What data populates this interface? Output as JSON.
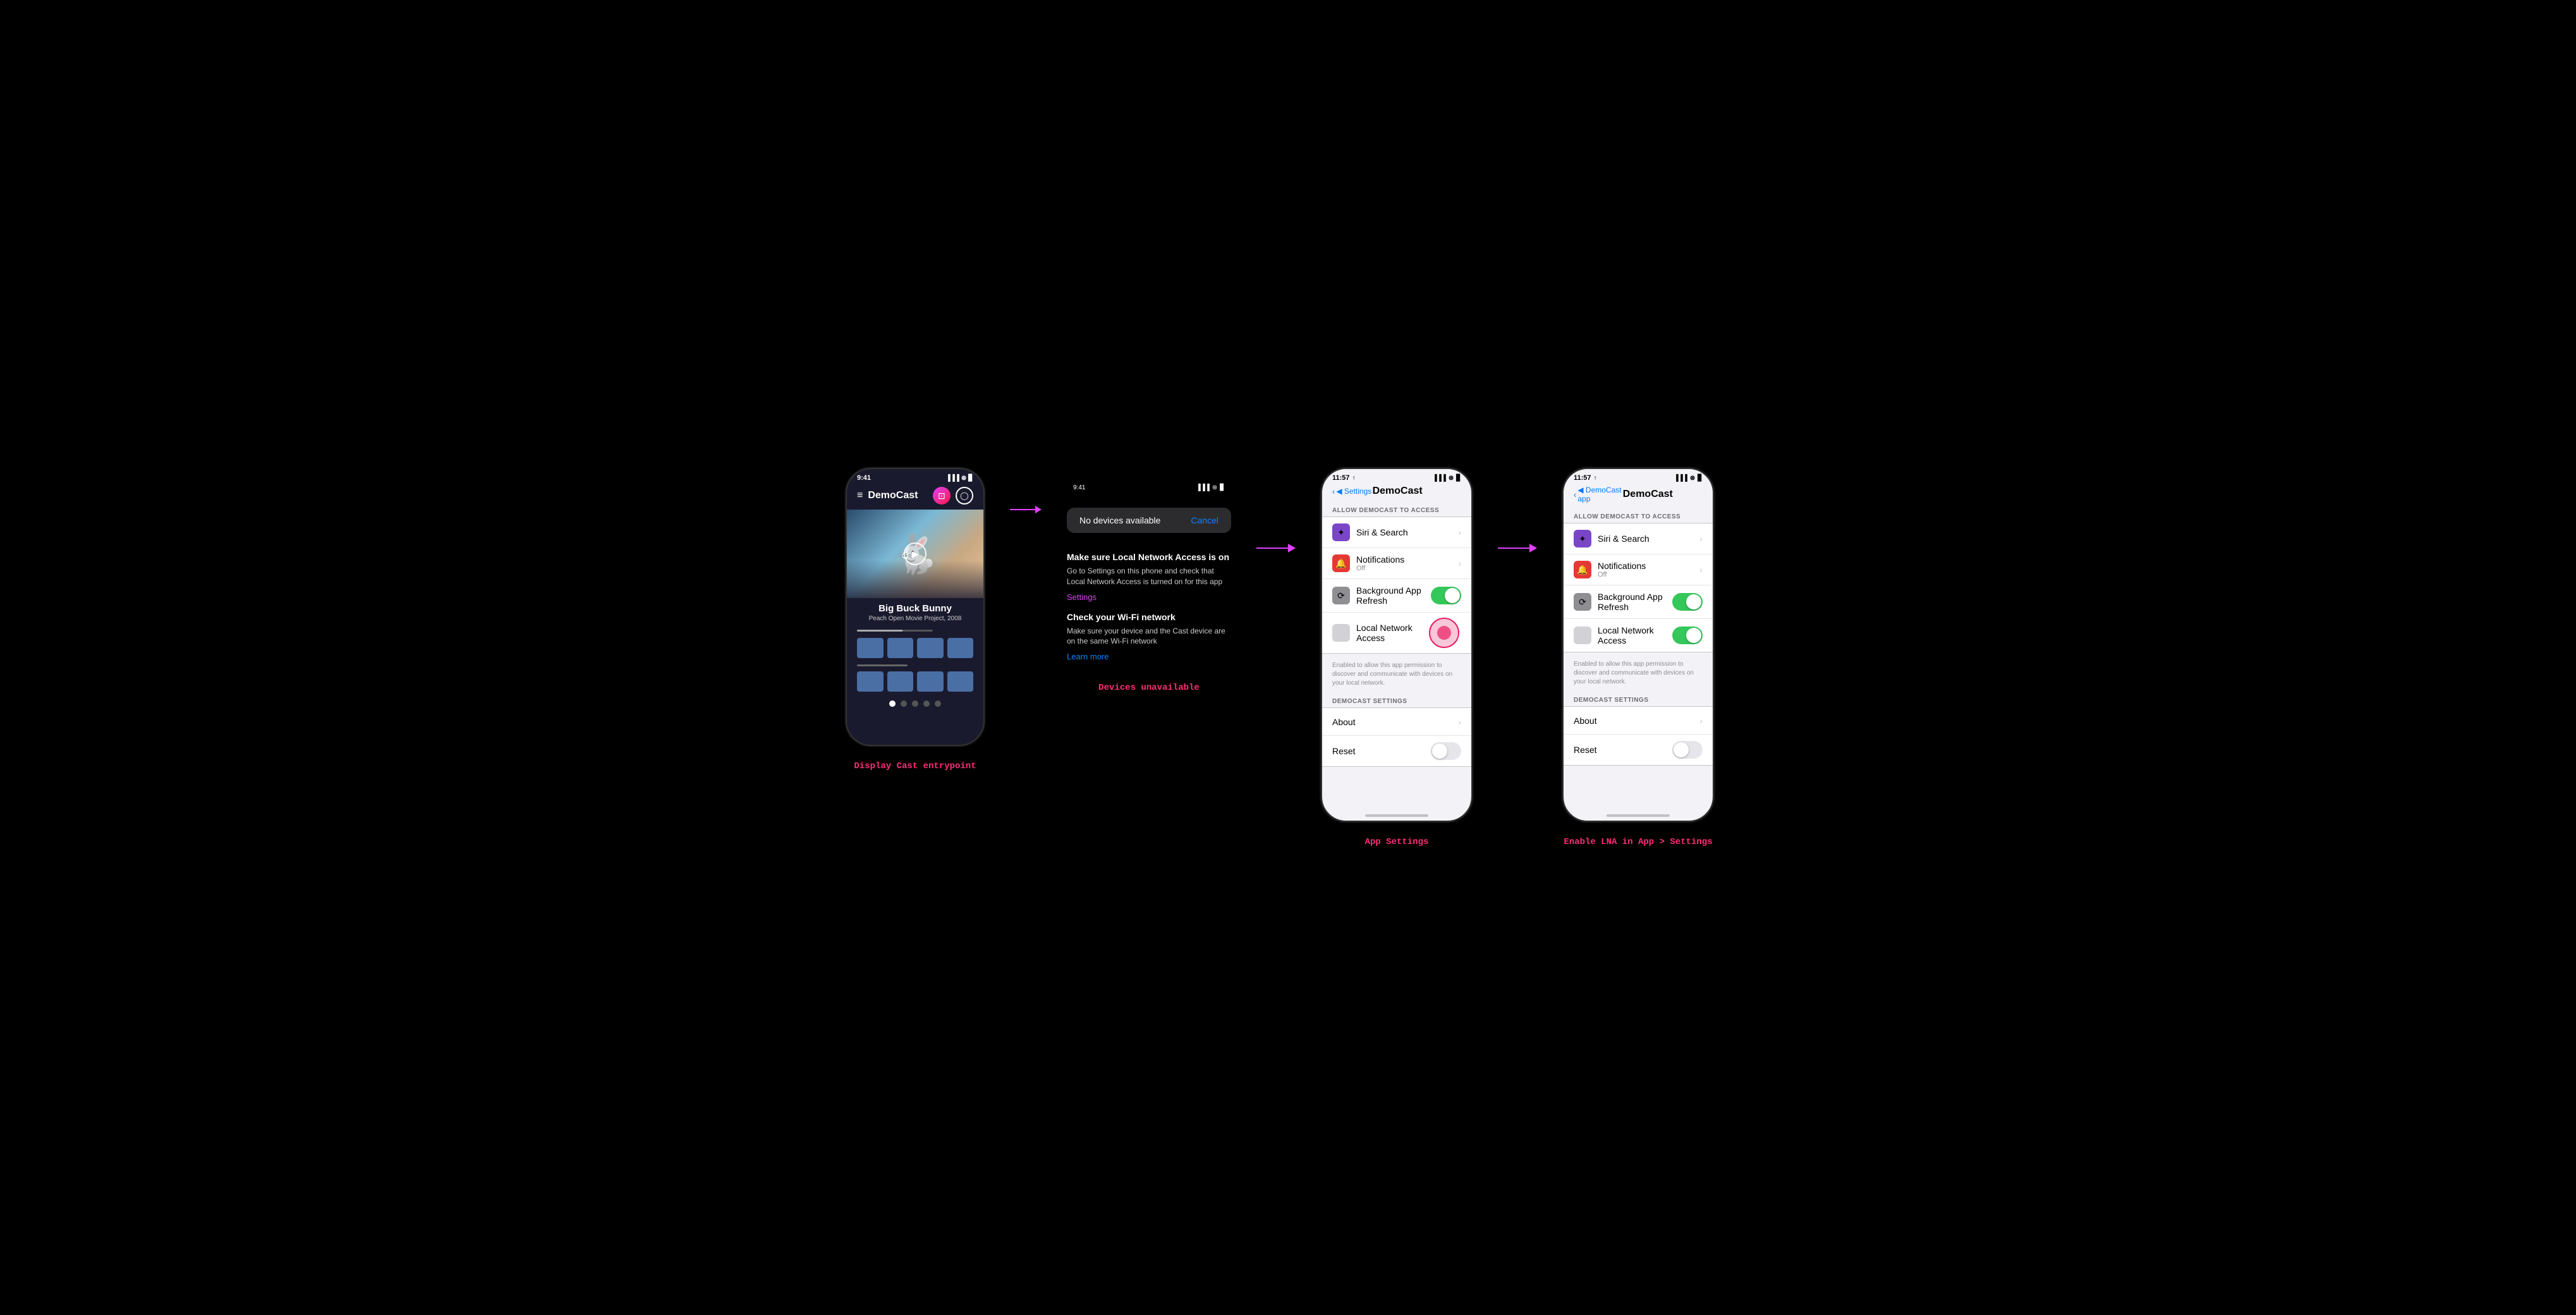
{
  "step1": {
    "label": "Display Cast entrypoint",
    "status_time": "9:41",
    "app_title": "DemoCast",
    "movie_title": "Big Buck Bunny",
    "movie_subtitle": "Peach Open Movie Project, 2008"
  },
  "step2": {
    "label": "Devices unavailable",
    "status_time": "9:41",
    "popup_text": "No devices available",
    "popup_cancel": "Cancel",
    "heading1": "Make sure Local Network Access is on",
    "desc1": "Go to Settings on this phone and check that Local Network Access is turned on for this app",
    "link1": "Settings",
    "heading2": "Check your Wi-Fi network",
    "desc2": "Make sure your device and the Cast device are on the same Wi-Fi network",
    "link2": "Learn more"
  },
  "step3": {
    "label": "App Settings",
    "status_time": "11:57",
    "back_label": "◀ Settings",
    "nav_title": "DemoCast",
    "section_allow": "ALLOW DEMOCAST TO ACCESS",
    "row_siri": "Siri & Search",
    "row_notifications": "Notifications",
    "row_notifications_sub": "Off",
    "row_bg_refresh": "Background App Refresh",
    "row_lna": "Local Network Access",
    "lna_desc": "Enabled to allow this app permission to discover and communicate with devices on your local network.",
    "section_settings": "DEMOCAST SETTINGS",
    "row_about": "About",
    "row_reset": "Reset"
  },
  "step4": {
    "label": "Enable LNA in App > Settings",
    "status_time": "11:57",
    "back_label": "◀ DemoCast app",
    "nav_title": "DemoCast",
    "section_allow": "ALLOW DEMOCAST TO ACCESS",
    "row_siri": "Siri & Search",
    "row_notifications": "Notifications",
    "row_notifications_sub": "Off",
    "row_bg_refresh": "Background App Refresh",
    "row_lna": "Local Network Access",
    "lna_desc": "Enabled to allow this app permission to discover and communicate with devices on your local network.",
    "section_settings": "DEMOCAST SETTINGS",
    "row_about": "About",
    "row_reset": "Reset"
  },
  "icons": {
    "signal": "▐▐▐",
    "wifi": "WiFi",
    "battery": "▊",
    "chevron": "›",
    "back_chevron": "‹"
  }
}
